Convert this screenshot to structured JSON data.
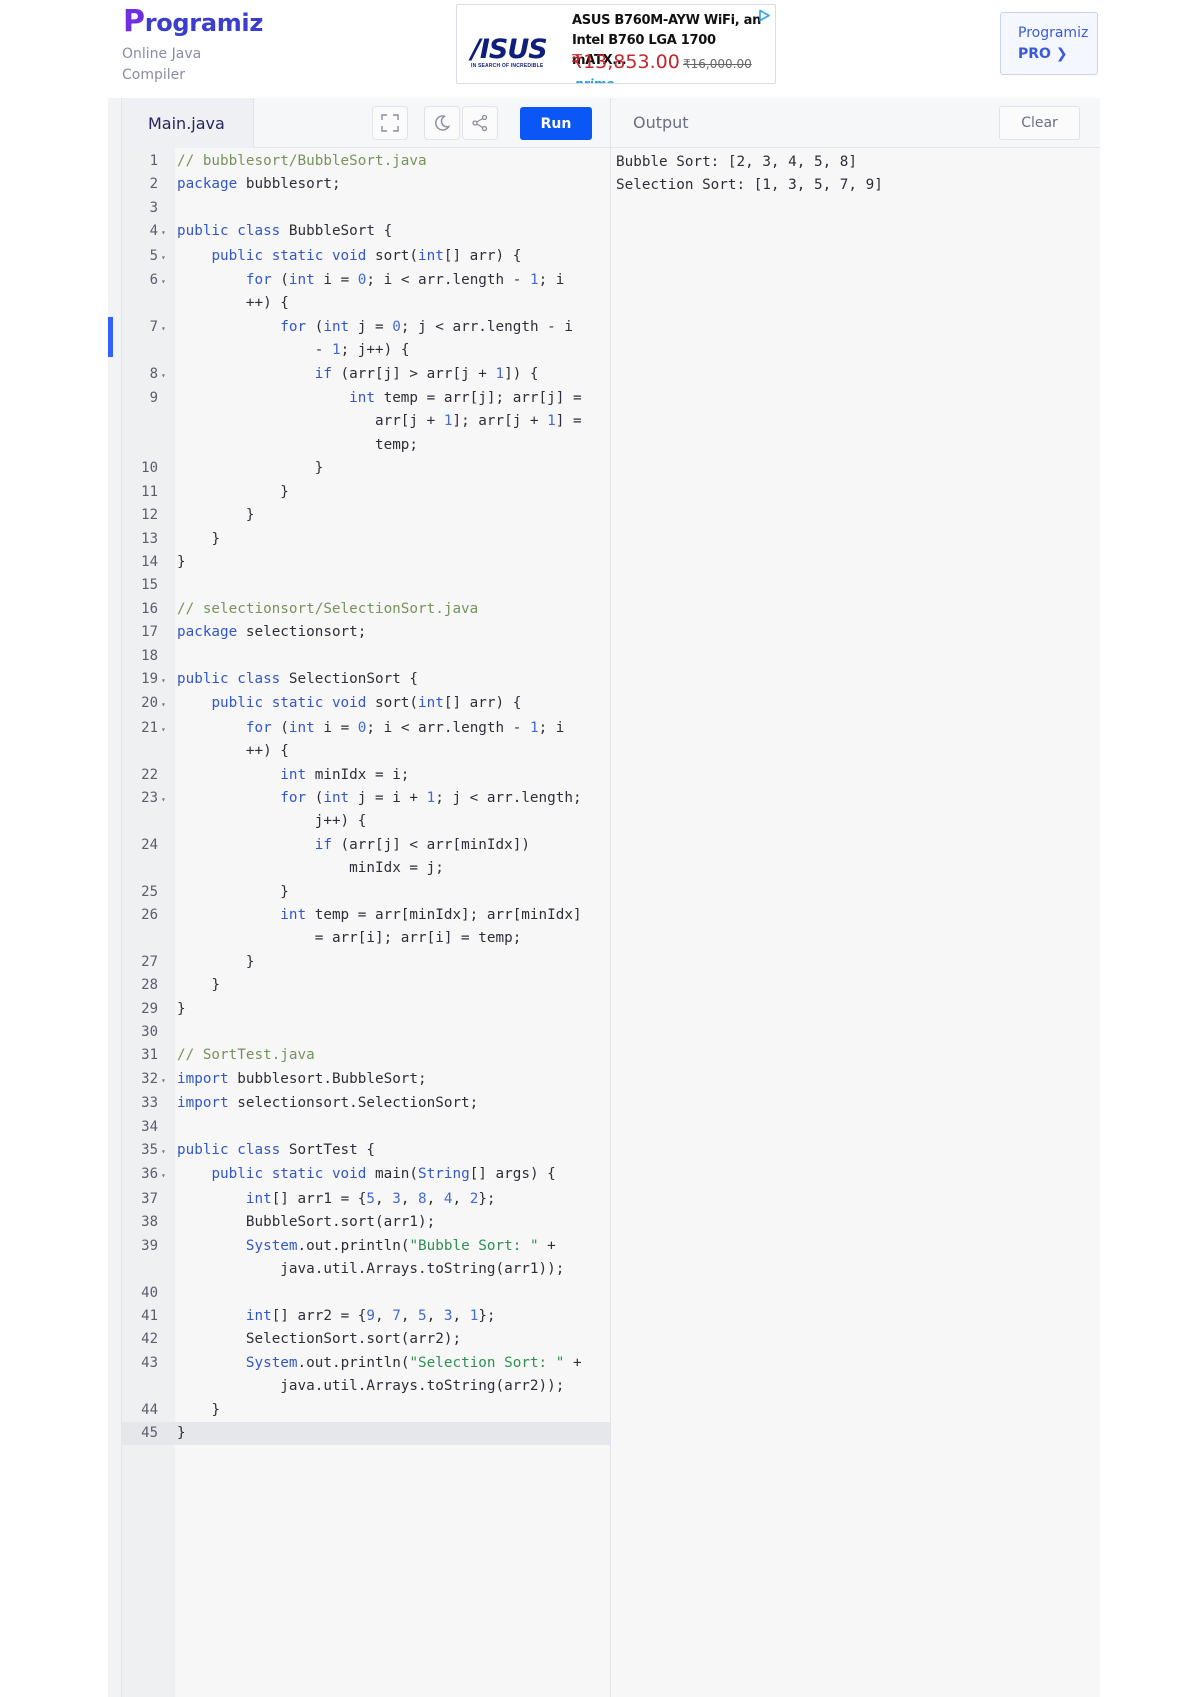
{
  "header": {
    "logo_text": "rogramiz",
    "logo_initial": "P",
    "subtitle": "Online Java Compiler",
    "ad": {
      "brand": "/ISUS",
      "tagline": "IN SEARCH OF INCREDIBLE",
      "title": "ASUS B760M-AYW WiFi, an Intel B760 LGA 1700 mATX...",
      "price": "₹13,853.00",
      "old_price": "₹16,000.00",
      "badge": "prime"
    },
    "pro_button": {
      "line1": "Programiz",
      "line2": "PRO ❯"
    }
  },
  "editor": {
    "file_tab": "Main.java",
    "run_label": "Run",
    "lines": [
      {
        "n": "1",
        "fold": false,
        "html": "<span class=\"c\">// bubblesort/BubbleSort.java</span>"
      },
      {
        "n": "2",
        "fold": false,
        "html": "<span class=\"k\">package</span> bubblesort;"
      },
      {
        "n": "3",
        "fold": false,
        "html": ""
      },
      {
        "n": "4",
        "fold": true,
        "html": "<span class=\"k\">public class</span> BubbleSort {"
      },
      {
        "n": "5",
        "fold": true,
        "html": "    <span class=\"k\">public static void</span> sort(<span class=\"k\">int</span>[] arr) {"
      },
      {
        "n": "6",
        "fold": true,
        "html": "        <span class=\"k\">for</span> (<span class=\"k\">int</span> i = <span class=\"n\">0</span>; i &lt; arr.length - <span class=\"n\">1</span>; i\n        ++) {"
      },
      {
        "n": "7",
        "fold": true,
        "html": "            <span class=\"k\">for</span> (<span class=\"k\">int</span> j = <span class=\"n\">0</span>; j &lt; arr.length - i\n                - <span class=\"n\">1</span>; j++) {"
      },
      {
        "n": "8",
        "fold": true,
        "html": "                <span class=\"k\">if</span> (arr[j] &gt; arr[j + <span class=\"n\">1</span>]) {"
      },
      {
        "n": "9",
        "fold": false,
        "html": "                    <span class=\"k\">int</span> temp = arr[j]; arr[j] =\n                       arr[j + <span class=\"n\">1</span>]; arr[j + <span class=\"n\">1</span>] =\n                       temp;"
      },
      {
        "n": "10",
        "fold": false,
        "html": "                }"
      },
      {
        "n": "11",
        "fold": false,
        "html": "            }"
      },
      {
        "n": "12",
        "fold": false,
        "html": "        }"
      },
      {
        "n": "13",
        "fold": false,
        "html": "    }"
      },
      {
        "n": "14",
        "fold": false,
        "html": "}"
      },
      {
        "n": "15",
        "fold": false,
        "html": ""
      },
      {
        "n": "16",
        "fold": false,
        "html": "<span class=\"c\">// selectionsort/SelectionSort.java</span>"
      },
      {
        "n": "17",
        "fold": false,
        "html": "<span class=\"k\">package</span> selectionsort;"
      },
      {
        "n": "18",
        "fold": false,
        "html": ""
      },
      {
        "n": "19",
        "fold": true,
        "html": "<span class=\"k\">public class</span> SelectionSort {"
      },
      {
        "n": "20",
        "fold": true,
        "html": "    <span class=\"k\">public static void</span> sort(<span class=\"k\">int</span>[] arr) {"
      },
      {
        "n": "21",
        "fold": true,
        "html": "        <span class=\"k\">for</span> (<span class=\"k\">int</span> i = <span class=\"n\">0</span>; i &lt; arr.length - <span class=\"n\">1</span>; i\n        ++) {"
      },
      {
        "n": "22",
        "fold": false,
        "html": "            <span class=\"k\">int</span> minIdx = i;"
      },
      {
        "n": "23",
        "fold": true,
        "html": "            <span class=\"k\">for</span> (<span class=\"k\">int</span> j = i + <span class=\"n\">1</span>; j &lt; arr.length;\n                j++) {"
      },
      {
        "n": "24",
        "fold": false,
        "html": "                <span class=\"k\">if</span> (arr[j] &lt; arr[minIdx])\n                    minIdx = j;"
      },
      {
        "n": "25",
        "fold": false,
        "html": "            }"
      },
      {
        "n": "26",
        "fold": false,
        "html": "            <span class=\"k\">int</span> temp = arr[minIdx]; arr[minIdx]\n                = arr[i]; arr[i] = temp;"
      },
      {
        "n": "27",
        "fold": false,
        "html": "        }"
      },
      {
        "n": "28",
        "fold": false,
        "html": "    }"
      },
      {
        "n": "29",
        "fold": false,
        "html": "}"
      },
      {
        "n": "30",
        "fold": false,
        "html": ""
      },
      {
        "n": "31",
        "fold": false,
        "html": "<span class=\"c\">// SortTest.java</span>"
      },
      {
        "n": "32",
        "fold": true,
        "html": "<span class=\"k\">import</span> bubblesort.BubbleSort;"
      },
      {
        "n": "33",
        "fold": false,
        "html": "<span class=\"k\">import</span> selectionsort.SelectionSort;"
      },
      {
        "n": "34",
        "fold": false,
        "html": ""
      },
      {
        "n": "35",
        "fold": true,
        "html": "<span class=\"k\">public class</span> SortTest {"
      },
      {
        "n": "36",
        "fold": true,
        "html": "    <span class=\"k\">public static void</span> main(<span class=\"k\">String</span>[] args) {"
      },
      {
        "n": "37",
        "fold": false,
        "html": "        <span class=\"k\">int</span>[] arr1 = {<span class=\"n\">5</span>, <span class=\"n\">3</span>, <span class=\"n\">8</span>, <span class=\"n\">4</span>, <span class=\"n\">2</span>};"
      },
      {
        "n": "38",
        "fold": false,
        "html": "        BubbleSort.sort(arr1);"
      },
      {
        "n": "39",
        "fold": false,
        "html": "        <span class=\"k\">System</span>.out.println(<span class=\"s\">\"Bubble Sort: \"</span> +\n            java.util.Arrays.toString(arr1));"
      },
      {
        "n": "40",
        "fold": false,
        "html": ""
      },
      {
        "n": "41",
        "fold": false,
        "html": "        <span class=\"k\">int</span>[] arr2 = {<span class=\"n\">9</span>, <span class=\"n\">7</span>, <span class=\"n\">5</span>, <span class=\"n\">3</span>, <span class=\"n\">1</span>};"
      },
      {
        "n": "42",
        "fold": false,
        "html": "        SelectionSort.sort(arr2);"
      },
      {
        "n": "43",
        "fold": false,
        "html": "        <span class=\"k\">System</span>.out.println(<span class=\"s\">\"Selection Sort: \"</span> +\n            java.util.Arrays.toString(arr2));"
      },
      {
        "n": "44",
        "fold": false,
        "html": "    }"
      },
      {
        "n": "45",
        "fold": false,
        "html": "}",
        "active": true
      }
    ]
  },
  "output": {
    "title": "Output",
    "clear_label": "Clear",
    "lines": [
      "Bubble Sort: [2, 3, 4, 5, 8]",
      "Selection Sort: [1, 3, 5, 7, 9]"
    ]
  }
}
